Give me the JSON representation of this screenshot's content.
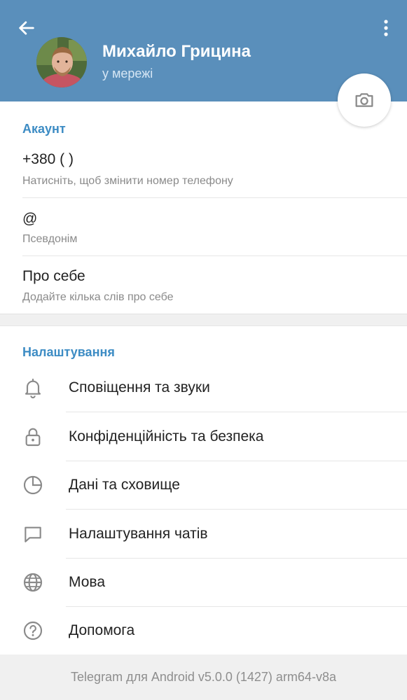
{
  "header": {
    "name": "Михайло Грицина",
    "status": "у мережі",
    "background_color": "#5a8fbb"
  },
  "account": {
    "title": "Акаунт",
    "phone": {
      "value": "+380 (    )",
      "hint": "Натисніть, щоб змінити номер телефону"
    },
    "username": {
      "value": "@",
      "hint": "Псевдонім"
    },
    "bio": {
      "value": "Про себе",
      "hint": "Додайте кілька слів про себе"
    }
  },
  "settings": {
    "title": "Налаштування",
    "items": [
      {
        "label": "Сповіщення та звуки",
        "icon": "bell-icon"
      },
      {
        "label": "Конфіденційність та безпека",
        "icon": "lock-icon"
      },
      {
        "label": "Дані та сховище",
        "icon": "pie-chart-icon"
      },
      {
        "label": "Налаштування чатів",
        "icon": "chat-bubble-icon"
      },
      {
        "label": "Мова",
        "icon": "globe-icon"
      },
      {
        "label": "Допомога",
        "icon": "question-icon"
      }
    ]
  },
  "footer": {
    "version": "Telegram для Android v5.0.0 (1427) arm64-v8a"
  },
  "colors": {
    "accent": "#3d8cc4",
    "icon": "#8a8a8a"
  }
}
